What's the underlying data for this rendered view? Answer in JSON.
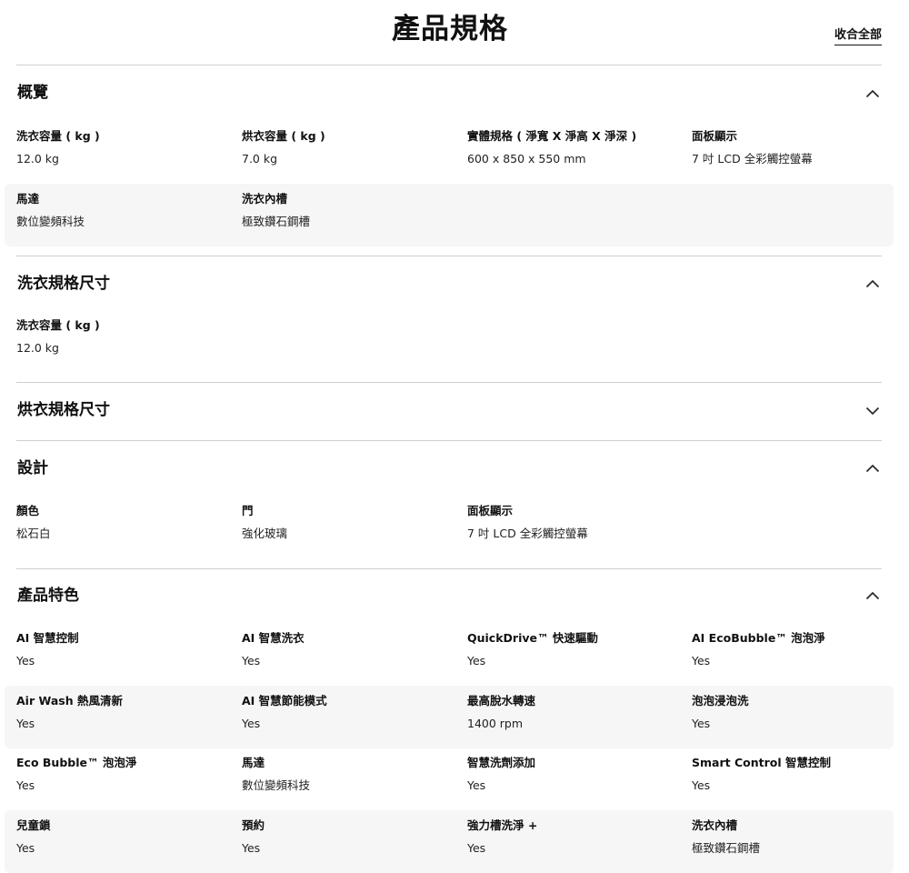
{
  "header": {
    "title": "產品規格",
    "collapse_all": "收合全部"
  },
  "sections": [
    {
      "title": "概覽",
      "expanded": true,
      "rows": [
        [
          {
            "label": "洗衣容量 ( kg )",
            "value": "12.0 kg"
          },
          {
            "label": "烘衣容量 ( kg )",
            "value": "7.0 kg"
          },
          {
            "label": "實體規格 ( 淨寬 X 淨高 X 淨深 )",
            "value": "600 x 850 x 550 mm"
          },
          {
            "label": "面板顯示",
            "value": "7 吋 LCD 全彩觸控螢幕"
          }
        ],
        [
          {
            "label": "馬達",
            "value": "數位變頻科技"
          },
          {
            "label": "洗衣內槽",
            "value": "極致鑽石鋼槽"
          }
        ]
      ]
    },
    {
      "title": "洗衣規格尺寸",
      "expanded": true,
      "rows": [
        [
          {
            "label": "洗衣容量 ( kg )",
            "value": "12.0 kg"
          }
        ]
      ]
    },
    {
      "title": "烘衣規格尺寸",
      "expanded": false,
      "rows": []
    },
    {
      "title": "設計",
      "expanded": true,
      "rows": [
        [
          {
            "label": "顏色",
            "value": "松石白"
          },
          {
            "label": "門",
            "value": "強化玻璃"
          },
          {
            "label": "面板顯示",
            "value": "7 吋 LCD 全彩觸控螢幕"
          }
        ]
      ]
    },
    {
      "title": "產品特色",
      "expanded": true,
      "rows": [
        [
          {
            "label": "AI 智慧控制",
            "value": "Yes"
          },
          {
            "label": "AI 智慧洗衣",
            "value": "Yes"
          },
          {
            "label": "QuickDrive™ 快速驅動",
            "value": "Yes"
          },
          {
            "label": "AI EcoBubble™ 泡泡淨",
            "value": "Yes"
          }
        ],
        [
          {
            "label": "Air Wash 熱風清新",
            "value": "Yes"
          },
          {
            "label": "AI 智慧節能模式",
            "value": "Yes"
          },
          {
            "label": "最高脫水轉速",
            "value": "1400 rpm"
          },
          {
            "label": "泡泡浸泡洗",
            "value": "Yes"
          }
        ],
        [
          {
            "label": "Eco Bubble™ 泡泡淨",
            "value": "Yes"
          },
          {
            "label": "馬達",
            "value": "數位變頻科技"
          },
          {
            "label": "智慧洗劑添加",
            "value": "Yes"
          },
          {
            "label": "Smart Control 智慧控制",
            "value": "Yes"
          }
        ],
        [
          {
            "label": "兒童鎖",
            "value": "Yes"
          },
          {
            "label": "預約",
            "value": "Yes"
          },
          {
            "label": "強力槽洗淨 +",
            "value": "Yes"
          },
          {
            "label": "洗衣內槽",
            "value": "極致鑽石鋼槽"
          }
        ]
      ]
    }
  ],
  "icons": {
    "expanded": "chevron-up-icon",
    "collapsed": "chevron-down-icon"
  },
  "colors": {
    "text": "#111111",
    "row_shade": "#f6f6f6",
    "divider": "#cfcfcf"
  }
}
